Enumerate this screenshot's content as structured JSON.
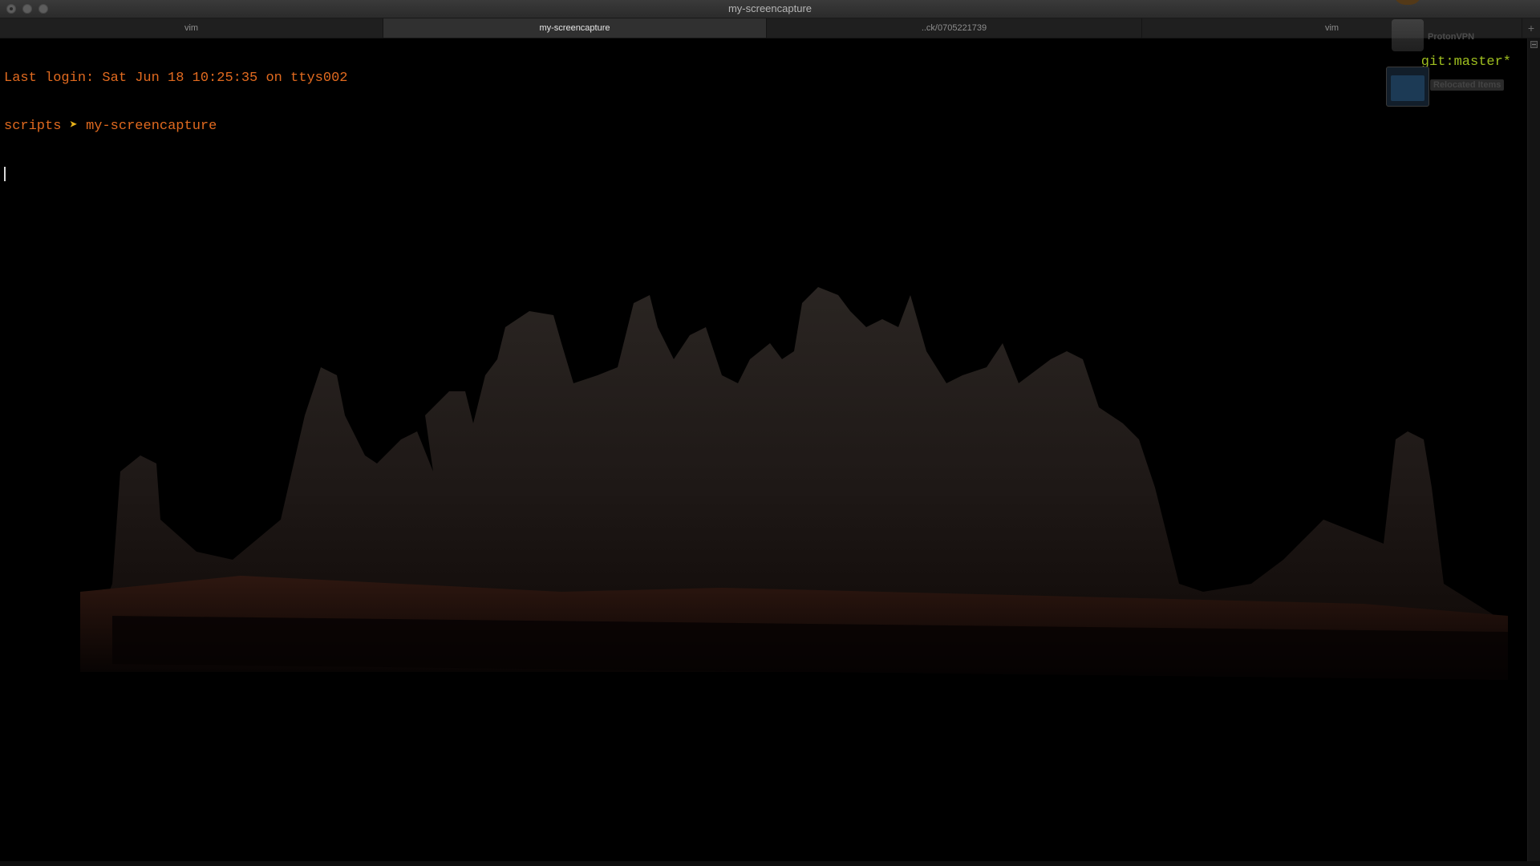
{
  "window": {
    "title": "my-screencapture"
  },
  "tabs": [
    {
      "label": "vim",
      "active": false
    },
    {
      "label": "my-screencapture",
      "active": true
    },
    {
      "label": "..ck/0705221739",
      "active": false
    },
    {
      "label": "vim",
      "active": false
    }
  ],
  "tab_add_label": "+",
  "terminal": {
    "last_login": "Last login: Sat Jun 18 10:25:35 on ttys002",
    "prompt_dir": "scripts",
    "prompt_arrow": "➤",
    "prompt_cwd": "my-screencapture",
    "git_status": "git:master*"
  },
  "desktop": {
    "drive_label": "ProtonVPN",
    "folder_label": "Relocated Items"
  },
  "colors": {
    "prompt_text": "#e16a1f",
    "prompt_arrow": "#e8b21a",
    "git_status": "#9fbf1f",
    "background": "#000000"
  }
}
